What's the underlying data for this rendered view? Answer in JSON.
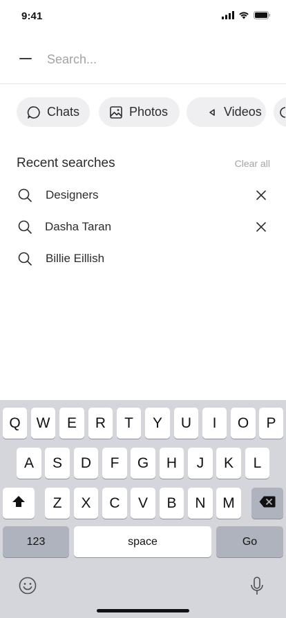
{
  "status_bar": {
    "time": "9:41"
  },
  "search": {
    "placeholder": "Search..."
  },
  "filters": [
    {
      "label": "Chats",
      "icon": "chat-bubble-icon"
    },
    {
      "label": "Photos",
      "icon": "image-icon"
    },
    {
      "label": "Videos",
      "icon": "play-icon"
    },
    {
      "label": "",
      "icon": "more-filter-icon"
    }
  ],
  "recent": {
    "title": "Recent searches",
    "clear_label": "Clear all",
    "items": [
      {
        "label": "Designers",
        "removable": true
      },
      {
        "label": "Dasha Taran",
        "removable": true
      },
      {
        "label": "Billie Eillish",
        "removable": false
      }
    ]
  },
  "keyboard": {
    "row1": [
      "Q",
      "W",
      "E",
      "R",
      "T",
      "Y",
      "U",
      "I",
      "O",
      "P"
    ],
    "row2": [
      "A",
      "S",
      "D",
      "F",
      "G",
      "H",
      "J",
      "K",
      "L"
    ],
    "row3": [
      "Z",
      "X",
      "C",
      "V",
      "B",
      "N",
      "M"
    ],
    "numbers_label": "123",
    "space_label": "space",
    "go_label": "Go"
  },
  "colors": {
    "chip_bg": "#efeff1",
    "keyboard_bg": "#d4d6dc",
    "dark_key": "#aeb3bd",
    "muted_text": "#a3a3a8"
  }
}
